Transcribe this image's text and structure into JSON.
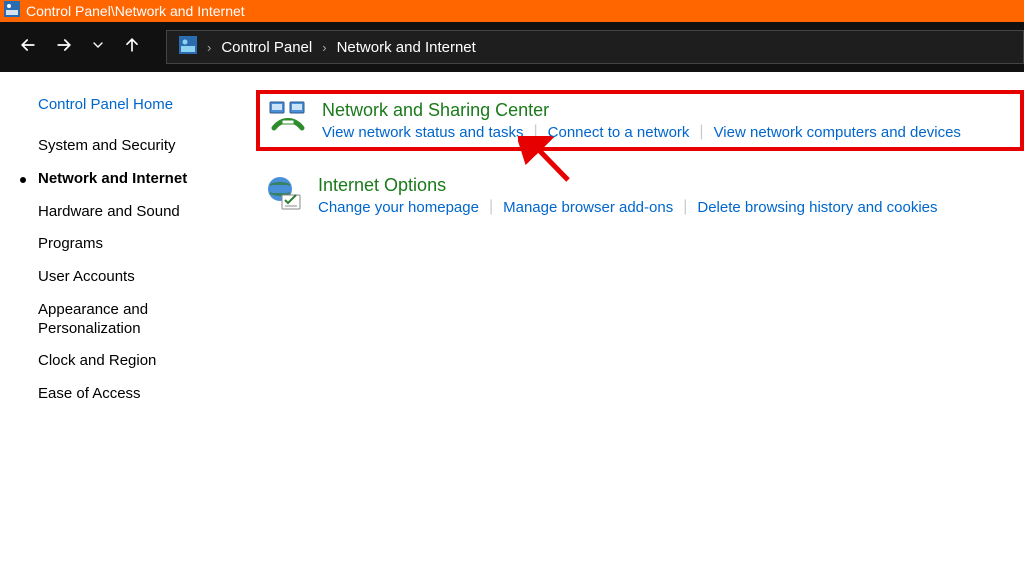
{
  "titlebar": {
    "path": "Control Panel\\Network and Internet"
  },
  "breadcrumbs": [
    "Control Panel",
    "Network and Internet"
  ],
  "sidebar": {
    "home": "Control Panel Home",
    "items": [
      "System and Security",
      "Network and Internet",
      "Hardware and Sound",
      "Programs",
      "User Accounts",
      "Appearance and Personalization",
      "Clock and Region",
      "Ease of Access"
    ],
    "activeIndex": 1
  },
  "categories": [
    {
      "title": "Network and Sharing Center",
      "links": [
        "View network status and tasks",
        "Connect to a network",
        "View network computers and devices"
      ],
      "highlight": true,
      "icon": "network-sharing-icon"
    },
    {
      "title": "Internet Options",
      "links": [
        "Change your homepage",
        "Manage browser add-ons",
        "Delete browsing history and cookies"
      ],
      "highlight": false,
      "icon": "internet-options-icon"
    }
  ]
}
